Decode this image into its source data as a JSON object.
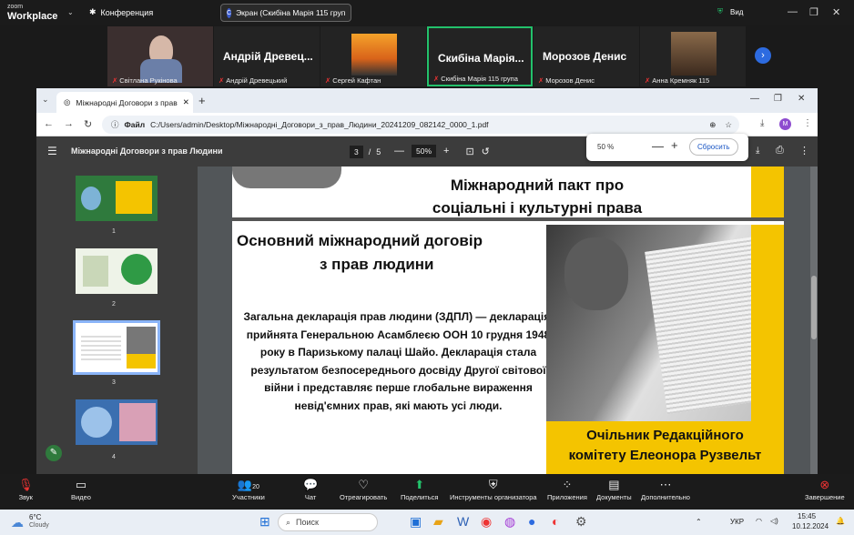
{
  "zoom": {
    "logo_small": "zoom",
    "logo_big": "Workplace",
    "conference_label": "Конференция",
    "screen_share_label": "Экран (Скибіна Марія 115 груп",
    "view_label": "Вид",
    "participants": [
      {
        "name": "Світлана Рукінова",
        "big": ""
      },
      {
        "name": "Андрій Древецький",
        "big": "Андрій Древец..."
      },
      {
        "name": "Сергей Кафтан",
        "big": ""
      },
      {
        "name": "Скибіна Марія 115 група",
        "big": "Скибіна Марія..."
      },
      {
        "name": "Морозов Денис",
        "big": "Морозов Денис"
      },
      {
        "name": "Анна Кремняк 115",
        "big": ""
      }
    ],
    "toolbar": {
      "audio": "Звук",
      "video": "Видео",
      "participants": "Участники",
      "participants_count": "20",
      "chat": "Чат",
      "react": "Отреагировать",
      "share": "Поделиться",
      "host_tools": "Инструменты организатора",
      "apps": "Приложения",
      "docs": "Документы",
      "more": "Дополнительно",
      "end": "Завершение"
    }
  },
  "browser": {
    "tab_title": "Міжнародні Договори з прав",
    "address_prefix": "Файл",
    "address_path": "C:/Users/admin/Desktop/Міжнародні_Договори_з_прав_Людини_20241209_082142_0000_1.pdf",
    "profile_initial": "M"
  },
  "pdf": {
    "title": "Міжнародні Договори з прав Людини",
    "page_current": "3",
    "page_sep": "/",
    "page_total": "5",
    "zoom_value": "50%",
    "popup_zoom": "50 %",
    "popup_reset": "Сбросить",
    "thumb_numbers": [
      "1",
      "2",
      "3",
      "4"
    ],
    "slide": {
      "top_title_line1": "Міжнародний пакт про",
      "top_title_line2": "соціальні і культурні права",
      "heading_line1": "Основний міжнародний договір",
      "heading_line2": "з прав людини",
      "body": "Загальна декларація прав людини (ЗДПЛ) — декларація, прийнята Генеральною Асамблеєю ООН 10 грудня 1948 року в Паризькому палаці Шайо. Декларація стала результатом безпосереднього досвіду Другої світової війни і представляє перше глобальне вираження невід'ємних прав, які мають усі люди.",
      "caption_line1": "Очільник Редакційного",
      "caption_line2": "комітету Елеонора Рузвельт"
    }
  },
  "taskbar": {
    "temp": "6°C",
    "weather": "Cloudy",
    "search": "Поиск",
    "lang": "УКР",
    "time": "15:45",
    "date": "10.12.2024"
  },
  "colors": {
    "accent_green": "#23c16b",
    "slide_yellow": "#f4c400",
    "zoom_blue": "#2d6be0"
  }
}
